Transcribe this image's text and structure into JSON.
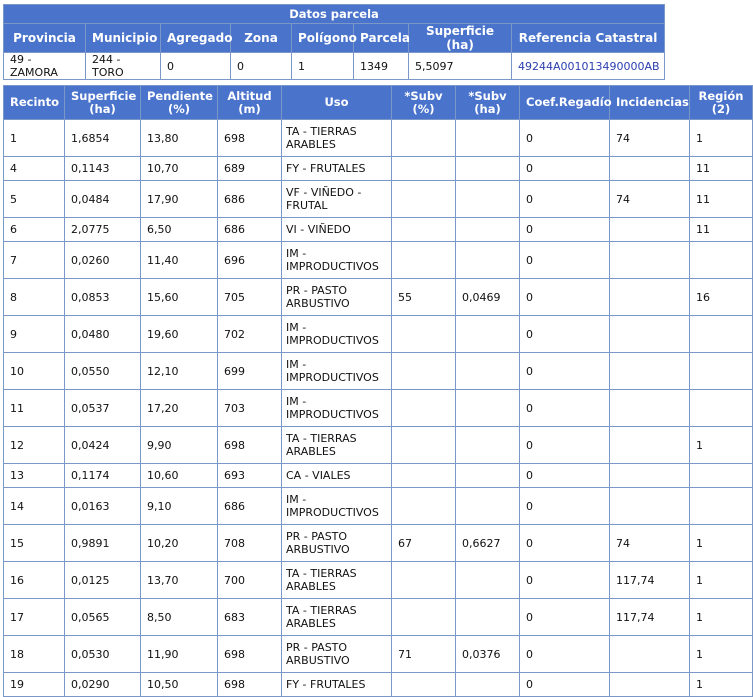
{
  "parcel": {
    "title": "Datos parcela",
    "headers": [
      "Provincia",
      "Municipio",
      "Agregado",
      "Zona",
      "Polígono",
      "Parcela",
      "Superficie (ha)",
      "Referencia Catastral"
    ],
    "values": [
      "49 - ZAMORA",
      "244 - TORO",
      "0",
      "0",
      "1",
      "1349",
      "5,5097",
      "49244A001013490000AB"
    ]
  },
  "recintos": {
    "headers": [
      {
        "l1": "Recinto",
        "l2": ""
      },
      {
        "l1": "Superficie",
        "l2": "(ha)"
      },
      {
        "l1": "Pendiente",
        "l2": "(%)"
      },
      {
        "l1": "Altitud",
        "l2": "(m)"
      },
      {
        "l1": "Uso",
        "l2": ""
      },
      {
        "l1": "*Subv",
        "l2": "(%)"
      },
      {
        "l1": "*Subv",
        "l2": "(ha)"
      },
      {
        "l1": "Coef.Regadío",
        "l2": ""
      },
      {
        "l1": "Incidencias",
        "l2": ""
      },
      {
        "l1": "Región",
        "l2": "(2)"
      }
    ],
    "rows": [
      {
        "recinto": "1",
        "superficie": "1,6854",
        "pendiente": "13,80",
        "altitud": "698",
        "uso1": "TA - TIERRAS",
        "uso2": "ARABLES",
        "subv_pct": "",
        "subv_ha": "",
        "coef": "0",
        "incidencias": "74",
        "region": "1"
      },
      {
        "recinto": "4",
        "superficie": "0,1143",
        "pendiente": "10,70",
        "altitud": "689",
        "uso1": "FY - FRUTALES",
        "uso2": "",
        "subv_pct": "",
        "subv_ha": "",
        "coef": "0",
        "incidencias": "",
        "region": "11"
      },
      {
        "recinto": "5",
        "superficie": "0,0484",
        "pendiente": "17,90",
        "altitud": "686",
        "uso1": "VF - VIÑEDO -",
        "uso2": "FRUTAL",
        "subv_pct": "",
        "subv_ha": "",
        "coef": "0",
        "incidencias": "74",
        "region": "11"
      },
      {
        "recinto": "6",
        "superficie": "2,0775",
        "pendiente": "6,50",
        "altitud": "686",
        "uso1": "VI - VIÑEDO",
        "uso2": "",
        "subv_pct": "",
        "subv_ha": "",
        "coef": "0",
        "incidencias": "",
        "region": "11"
      },
      {
        "recinto": "7",
        "superficie": "0,0260",
        "pendiente": "11,40",
        "altitud": "696",
        "uso1": "IM -",
        "uso2": "IMPRODUCTIVOS",
        "subv_pct": "",
        "subv_ha": "",
        "coef": "0",
        "incidencias": "",
        "region": ""
      },
      {
        "recinto": "8",
        "superficie": "0,0853",
        "pendiente": "15,60",
        "altitud": "705",
        "uso1": "PR - PASTO",
        "uso2": "ARBUSTIVO",
        "subv_pct": "55",
        "subv_ha": "0,0469",
        "coef": "0",
        "incidencias": "",
        "region": "16"
      },
      {
        "recinto": "9",
        "superficie": "0,0480",
        "pendiente": "19,60",
        "altitud": "702",
        "uso1": "IM -",
        "uso2": "IMPRODUCTIVOS",
        "subv_pct": "",
        "subv_ha": "",
        "coef": "0",
        "incidencias": "",
        "region": ""
      },
      {
        "recinto": "10",
        "superficie": "0,0550",
        "pendiente": "12,10",
        "altitud": "699",
        "uso1": "IM -",
        "uso2": "IMPRODUCTIVOS",
        "subv_pct": "",
        "subv_ha": "",
        "coef": "0",
        "incidencias": "",
        "region": ""
      },
      {
        "recinto": "11",
        "superficie": "0,0537",
        "pendiente": "17,20",
        "altitud": "703",
        "uso1": "IM -",
        "uso2": "IMPRODUCTIVOS",
        "subv_pct": "",
        "subv_ha": "",
        "coef": "0",
        "incidencias": "",
        "region": ""
      },
      {
        "recinto": "12",
        "superficie": "0,0424",
        "pendiente": "9,90",
        "altitud": "698",
        "uso1": "TA - TIERRAS",
        "uso2": "ARABLES",
        "subv_pct": "",
        "subv_ha": "",
        "coef": "0",
        "incidencias": "",
        "region": "1"
      },
      {
        "recinto": "13",
        "superficie": "0,1174",
        "pendiente": "10,60",
        "altitud": "693",
        "uso1": "CA - VIALES",
        "uso2": "",
        "subv_pct": "",
        "subv_ha": "",
        "coef": "0",
        "incidencias": "",
        "region": ""
      },
      {
        "recinto": "14",
        "superficie": "0,0163",
        "pendiente": "9,10",
        "altitud": "686",
        "uso1": "IM -",
        "uso2": "IMPRODUCTIVOS",
        "subv_pct": "",
        "subv_ha": "",
        "coef": "0",
        "incidencias": "",
        "region": ""
      },
      {
        "recinto": "15",
        "superficie": "0,9891",
        "pendiente": "10,20",
        "altitud": "708",
        "uso1": "PR - PASTO",
        "uso2": "ARBUSTIVO",
        "subv_pct": "67",
        "subv_ha": "0,6627",
        "coef": "0",
        "incidencias": "74",
        "region": "1"
      },
      {
        "recinto": "16",
        "superficie": "0,0125",
        "pendiente": "13,70",
        "altitud": "700",
        "uso1": "TA - TIERRAS",
        "uso2": "ARABLES",
        "subv_pct": "",
        "subv_ha": "",
        "coef": "0",
        "incidencias": "117,74",
        "region": "1"
      },
      {
        "recinto": "17",
        "superficie": "0,0565",
        "pendiente": "8,50",
        "altitud": "683",
        "uso1": "TA - TIERRAS",
        "uso2": "ARABLES",
        "subv_pct": "",
        "subv_ha": "",
        "coef": "0",
        "incidencias": "117,74",
        "region": "1"
      },
      {
        "recinto": "18",
        "superficie": "0,0530",
        "pendiente": "11,90",
        "altitud": "698",
        "uso1": "PR - PASTO",
        "uso2": "ARBUSTIVO",
        "subv_pct": "71",
        "subv_ha": "0,0376",
        "coef": "0",
        "incidencias": "",
        "region": "1"
      },
      {
        "recinto": "19",
        "superficie": "0,0290",
        "pendiente": "10,50",
        "altitud": "698",
        "uso1": "FY - FRUTALES",
        "uso2": "",
        "subv_pct": "",
        "subv_ha": "",
        "coef": "0",
        "incidencias": "",
        "region": "1"
      }
    ]
  }
}
